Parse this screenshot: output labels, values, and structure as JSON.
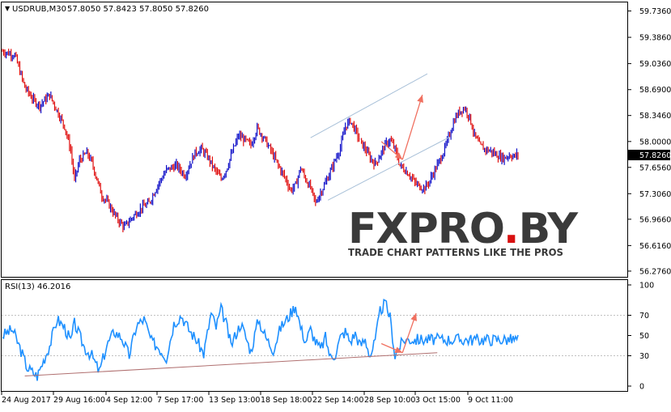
{
  "colors": {
    "background": "#ffffff",
    "frame": "#000000",
    "candle_up": "#1010c8",
    "candle_down": "#e01010",
    "rsi_line": "#1e90ff",
    "channel_line": "#a8c0d8",
    "rsi_trendline": "#b07070",
    "projection_arrow": "#f07060",
    "price_label_bg": "#000000",
    "price_label_fg": "#ffffff",
    "watermark_dark": "#3a3a3a",
    "watermark_red": "#d81010"
  },
  "price_header": {
    "symbol": "USDRUB,M30",
    "ohlc": "57.8050 57.8423 57.8050 57.8260"
  },
  "rsi_header": {
    "label": "RSI(13) 46.2016"
  },
  "current_price_label": "57.8260",
  "watermark": {
    "brand_dark": "FXPRO",
    "brand_red": ".",
    "brand_end": "BY",
    "tagline": "TRADE CHART PATTERNS LIKE THE PROS"
  },
  "chart_data": [
    {
      "type": "candlestick",
      "title": "USDRUB,M30",
      "price_axis_ticks": [
        "59.7360",
        "59.3860",
        "59.0360",
        "58.6900",
        "58.3460",
        "58.0000",
        "57.6560",
        "57.3060",
        "56.9660",
        "56.6160",
        "56.2760"
      ],
      "ylim": [
        56.2,
        59.85
      ],
      "x_tick_labels": [
        "24 Aug 2017",
        "29 Aug 16:00",
        "4 Sep 12:00",
        "7 Sep 17:00",
        "13 Sep 13:00",
        "18 Sep 18:00",
        "22 Sep 14:00",
        "28 Sep 10:00",
        "3 Oct 15:00",
        "9 Oct 11:00"
      ],
      "price_path": {
        "x_index": [
          0,
          10,
          18,
          25,
          30,
          38,
          42,
          50,
          55,
          58,
          62,
          68,
          72,
          80,
          85,
          92,
          98,
          105,
          112,
          118,
          125,
          132,
          140,
          147,
          155,
          160,
          165,
          170,
          176,
          180,
          185,
          190,
          195,
          200,
          205,
          210,
          216,
          222,
          228,
          232,
          236,
          240,
          244,
          248,
          252,
          256,
          260,
          266,
          272,
          276,
          280,
          284,
          288,
          292,
          296,
          300,
          304,
          308,
          312,
          316,
          320,
          324,
          328,
          332,
          336,
          340,
          344,
          348,
          352,
          356,
          360,
          364,
          368,
          372,
          376,
          380,
          384,
          388,
          392,
          396,
          400,
          404,
          408,
          412,
          415
        ],
        "close": [
          59.2,
          59.15,
          58.72,
          58.55,
          58.48,
          58.62,
          58.48,
          58.2,
          57.88,
          57.48,
          57.75,
          57.85,
          57.72,
          57.28,
          57.18,
          56.98,
          56.86,
          57.0,
          57.12,
          57.18,
          57.42,
          57.62,
          57.68,
          57.55,
          57.85,
          57.9,
          57.8,
          57.65,
          57.5,
          57.62,
          57.86,
          58.08,
          58.02,
          57.95,
          58.18,
          58.06,
          57.88,
          57.68,
          57.5,
          57.35,
          57.42,
          57.65,
          57.5,
          57.38,
          57.18,
          57.32,
          57.45,
          57.68,
          57.92,
          58.2,
          58.28,
          58.15,
          58.0,
          57.9,
          57.78,
          57.7,
          57.82,
          57.95,
          58.02,
          57.9,
          57.68,
          57.62,
          57.55,
          57.45,
          57.4,
          57.38,
          57.48,
          57.62,
          57.75,
          57.9,
          58.1,
          58.3,
          58.4,
          58.45,
          58.32,
          58.08,
          57.95,
          57.9,
          57.88,
          57.84,
          57.8,
          57.78,
          57.82,
          57.8,
          57.83
        ]
      },
      "channel_upper": {
        "x_index": [
          248,
          342
        ],
        "y": [
          58.05,
          58.9
        ]
      },
      "channel_lower": {
        "x_index": [
          262,
          360
        ],
        "y": [
          57.22,
          58.06
        ]
      },
      "projection_down": {
        "x_index": [
          305,
          322
        ],
        "y": [
          58.0,
          57.76
        ]
      },
      "projection_up": {
        "x_index": [
          322,
          338
        ],
        "y": [
          57.76,
          58.62
        ]
      }
    },
    {
      "type": "line",
      "title": "RSI(13) 46.2016",
      "ylim": [
        0,
        100
      ],
      "y_ticks": [
        100,
        70,
        50,
        30,
        0
      ],
      "levels": [
        70,
        30
      ],
      "series": [
        {
          "x_index": [
            0,
            8,
            14,
            20,
            28,
            32,
            38,
            44,
            50,
            55,
            58,
            62,
            66,
            72,
            78,
            84,
            90,
            96,
            102,
            108,
            114,
            120,
            126,
            132,
            138,
            144,
            150,
            156,
            162,
            168,
            172,
            176,
            180,
            184,
            188,
            192,
            196,
            200,
            206,
            212,
            218,
            224,
            230,
            236,
            240,
            244,
            248,
            252,
            256,
            260,
            264,
            268,
            272,
            276,
            280,
            284,
            288,
            292,
            296,
            300,
            304,
            308,
            312,
            316,
            320,
            324
          ],
          "values": [
            50,
            56,
            38,
            18,
            10,
            22,
            40,
            66,
            58,
            44,
            62,
            50,
            38,
            30,
            14,
            40,
            54,
            48,
            30,
            60,
            66,
            44,
            38,
            28,
            62,
            70,
            56,
            46,
            32,
            72,
            58,
            76,
            62,
            40,
            52,
            62,
            48,
            34,
            66,
            48,
            36,
            58,
            68,
            80,
            58,
            44,
            56,
            44,
            36,
            48,
            28,
            32,
            48,
            54,
            44,
            52,
            40,
            46,
            30,
            44,
            74,
            82,
            68,
            30,
            40,
            46
          ]
        }
      ],
      "trendline": {
        "x_index": [
          18,
          350
        ],
        "y": [
          10,
          33
        ]
      },
      "projection_down": {
        "x_index": [
          305,
          322
        ],
        "y": [
          42,
          33
        ]
      },
      "projection_up": {
        "x_index": [
          322,
          333
        ],
        "y": [
          33,
          72
        ]
      }
    }
  ]
}
